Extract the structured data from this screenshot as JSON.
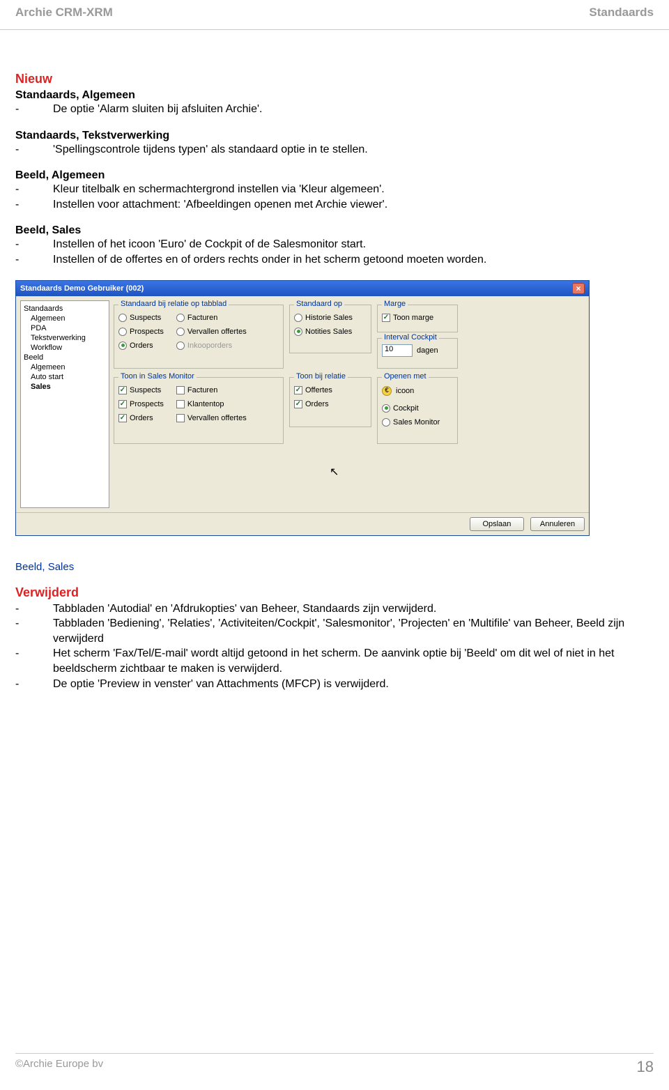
{
  "header": {
    "left": "Archie CRM-XRM",
    "right": "Standaards"
  },
  "nieuw": {
    "title": "Nieuw",
    "groups": [
      {
        "head": "Standaards, Algemeen",
        "items": [
          "De optie 'Alarm sluiten bij afsluiten Archie'."
        ]
      },
      {
        "head": "Standaards, Tekstverwerking",
        "items": [
          "'Spellingscontrole tijdens typen' als standaard optie in te stellen."
        ]
      },
      {
        "head": "Beeld, Algemeen",
        "items": [
          "Kleur titelbalk en schermachtergrond instellen via 'Kleur algemeen'.",
          "Instellen voor attachment: 'Afbeeldingen openen met Archie viewer'."
        ]
      },
      {
        "head": "Beeld, Sales",
        "items": [
          "Instellen of het icoon 'Euro' de Cockpit of de Salesmonitor start.",
          "Instellen of de offertes en of orders rechts onder in het scherm getoond moeten worden."
        ]
      }
    ]
  },
  "dialog": {
    "title": "Standaards Demo Gebruiker (002)",
    "sidebar": {
      "groups": [
        {
          "label": "Standaards",
          "items": [
            "Algemeen",
            "PDA",
            "Tekstverwerking",
            "Workflow"
          ]
        },
        {
          "label": "Beeld",
          "items": [
            "Algemeen",
            "Auto start"
          ]
        }
      ],
      "selected": "Sales"
    },
    "panels": {
      "standaard_tabblad": {
        "legend": "Standaard bij relatie op tabblad",
        "col1": [
          {
            "label": "Suspects",
            "sel": false
          },
          {
            "label": "Prospects",
            "sel": false
          },
          {
            "label": "Orders",
            "sel": true
          }
        ],
        "col2": [
          {
            "label": "Facturen",
            "sel": false
          },
          {
            "label": "Vervallen offertes",
            "sel": false
          },
          {
            "label": "Inkooporders",
            "sel": false,
            "disabled": true
          }
        ]
      },
      "standaard_op": {
        "legend": "Standaard op",
        "items": [
          {
            "label": "Historie Sales",
            "sel": false
          },
          {
            "label": "Notities Sales",
            "sel": true
          }
        ]
      },
      "marge": {
        "legend": "Marge",
        "check": {
          "label": "Toon marge",
          "sel": true
        }
      },
      "interval": {
        "legend": "Interval Cockpit",
        "value": "10",
        "unit": "dagen"
      },
      "toon_sales": {
        "legend": "Toon in Sales Monitor",
        "col1": [
          {
            "label": "Suspects",
            "sel": true
          },
          {
            "label": "Prospects",
            "sel": true
          },
          {
            "label": "Orders",
            "sel": true
          }
        ],
        "col2": [
          {
            "label": "Facturen",
            "sel": false
          },
          {
            "label": "Klantentop",
            "sel": false
          },
          {
            "label": "Vervallen offertes",
            "sel": false
          }
        ]
      },
      "toon_relatie": {
        "legend": "Toon bij relatie",
        "items": [
          {
            "label": "Offertes",
            "sel": true
          },
          {
            "label": "Orders",
            "sel": true
          }
        ]
      },
      "openen_met": {
        "legend": "Openen met",
        "icon_label": "icoon",
        "items": [
          {
            "label": "Cockpit",
            "sel": true
          },
          {
            "label": "Sales Monitor",
            "sel": false
          }
        ]
      }
    },
    "buttons": {
      "save": "Opslaan",
      "cancel": "Annuleren"
    }
  },
  "post_dialog_caption": "Beeld, Sales",
  "verwijderd": {
    "title": "Verwijderd",
    "items": [
      "Tabbladen 'Autodial' en 'Afdrukopties' van Beheer, Standaards zijn verwijderd.",
      "Tabbladen 'Bediening', 'Relaties', 'Activiteiten/Cockpit', 'Salesmonitor', 'Projecten' en 'Multifile' van Beheer, Beeld zijn verwijderd",
      "Het scherm 'Fax/Tel/E-mail' wordt altijd getoond in het scherm. De aanvink optie  bij 'Beeld' om dit wel of niet in het beeldscherm zichtbaar te maken is verwijderd.",
      "De optie 'Preview in venster' van Attachments (MFCP) is verwijderd."
    ]
  },
  "footer": {
    "left": "©Archie Europe bv",
    "page": "18"
  }
}
